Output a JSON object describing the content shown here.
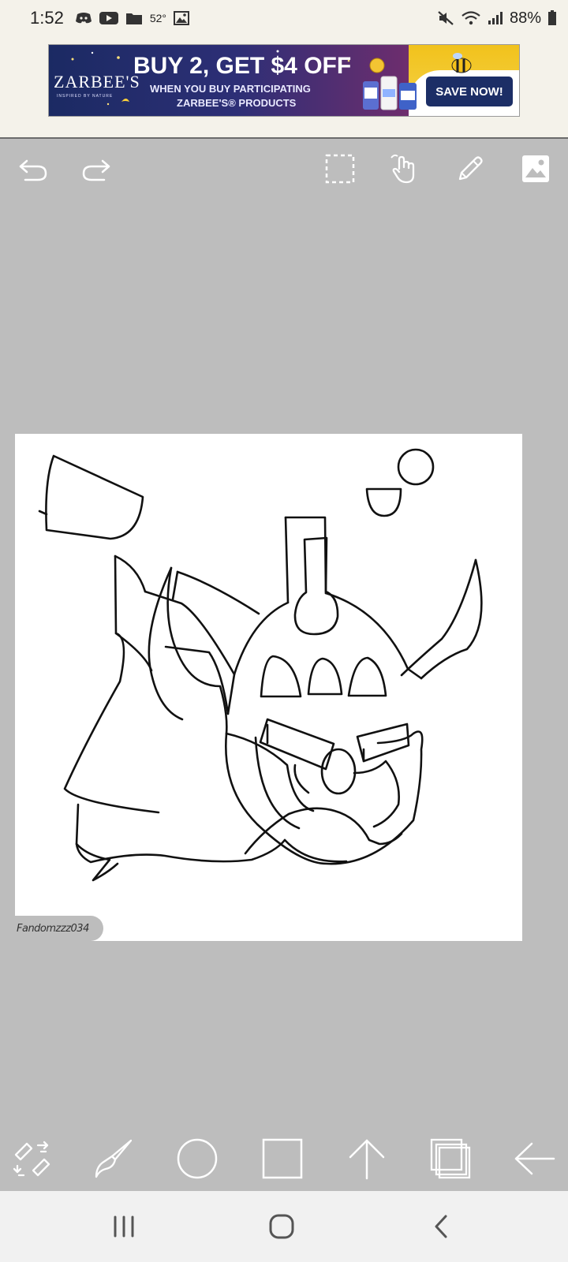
{
  "status_bar": {
    "time": "1:52",
    "temperature": "52°",
    "battery": "88%",
    "icons_left": [
      "discord-icon",
      "youtube-icon",
      "folder-icon",
      "image-icon"
    ],
    "icons_right": [
      "mute-icon",
      "wifi-icon",
      "signal-icon",
      "battery-icon"
    ]
  },
  "ad": {
    "brand": "ZARBEE'S",
    "brand_tagline": "INSPIRED BY NATURE",
    "headline": "BUY 2, GET $4 OFF",
    "line1": "WHEN YOU BUY PARTICIPATING",
    "line2": "ZARBEE'S® PRODUCTS",
    "cta": "SAVE NOW!",
    "colors": {
      "bg_left": "#1b2a63",
      "bg_right": "#b54a6a",
      "cta": "#1c2e66",
      "accent": "#f1c21c"
    }
  },
  "top_toolbar": {
    "items": [
      "undo-icon",
      "redo-icon",
      "selection-icon",
      "hand-icon",
      "pen-icon",
      "image-icon"
    ]
  },
  "canvas": {
    "watermark": "Fandomzzz034"
  },
  "bottom_toolbar": {
    "items": [
      "transform-icon",
      "brush-icon",
      "circle-icon",
      "square-icon",
      "arrow-up-icon",
      "layers-icon",
      "back-arrow-icon"
    ]
  },
  "nav_bar": {
    "items": [
      "recents-icon",
      "home-icon",
      "back-icon"
    ]
  },
  "colors": {
    "workspace": "#bdbdbd",
    "canvas": "#ffffff",
    "icon": "#ffffff",
    "status_bg": "#f4f2ea"
  }
}
